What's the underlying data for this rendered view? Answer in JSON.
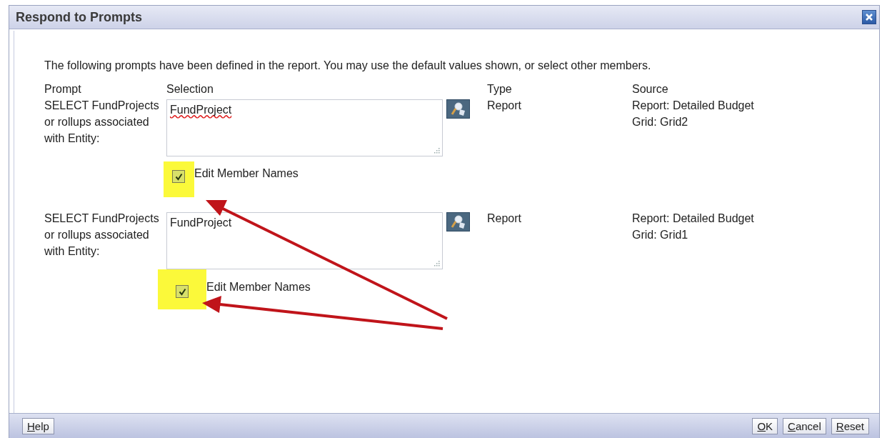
{
  "dialog": {
    "title": "Respond to Prompts"
  },
  "intro": "The following prompts have been defined in the report. You may use the default values shown, or select other members.",
  "columns": [
    "Prompt",
    "Selection",
    "Type",
    "Source"
  ],
  "prompts": [
    {
      "prompt": "SELECT FundProjects or rollups associated with Entity:",
      "selection": "FundProject",
      "misspelled": true,
      "edit_member_names": {
        "label": "Edit Member Names",
        "checked": true,
        "highlighted": true
      },
      "type": "Report",
      "source": [
        "Report: Detailed Budget",
        "Grid: Grid2"
      ]
    },
    {
      "prompt": "SELECT FundProjects or rollups associated with Entity:",
      "selection": "FundProject",
      "misspelled": false,
      "edit_member_names": {
        "label": "Edit Member Names",
        "checked": true,
        "highlighted": true
      },
      "type": "Report",
      "source": [
        "Report: Detailed Budget",
        "Grid: Grid1"
      ]
    }
  ],
  "footer": {
    "left_buttons": [
      "Help"
    ],
    "right_buttons": [
      "OK",
      "Cancel",
      "Reset"
    ]
  }
}
